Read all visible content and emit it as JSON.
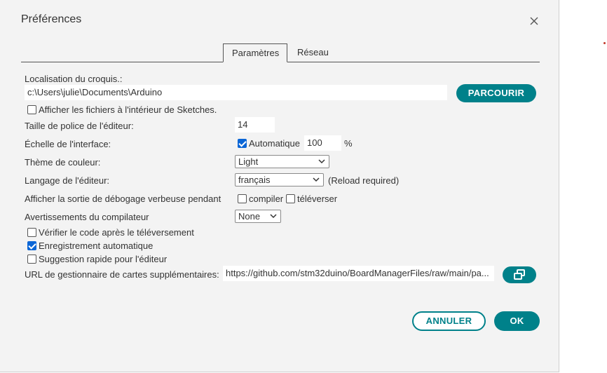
{
  "dialog": {
    "title": "Préférences"
  },
  "tabs": [
    {
      "label": "Paramètres"
    },
    {
      "label": "Réseau"
    }
  ],
  "sketchbook": {
    "label": "Localisation du croquis.:",
    "path": "c:\\Users\\julie\\Documents\\Arduino",
    "browse_label": "PARCOURIR",
    "show_files_label": "Afficher les fichiers à l'intérieur de Sketches.",
    "show_files_checked": false
  },
  "font_size": {
    "label": "Taille de police de l'éditeur:",
    "value": "14"
  },
  "scale": {
    "label": "Échelle de l'interface:",
    "auto_label": "Automatique",
    "auto_checked": true,
    "value": "100",
    "unit": "%"
  },
  "theme": {
    "label": "Thème de couleur:",
    "value": "Light"
  },
  "language": {
    "label": "Langage de l'éditeur:",
    "value": "français",
    "note": "(Reload required)"
  },
  "verbose": {
    "label": "Afficher la sortie de débogage verbeuse pendant",
    "compile_label": "compiler",
    "compile_checked": false,
    "upload_label": "téléverser",
    "upload_checked": false
  },
  "warnings": {
    "label": "Avertissements du compilateur",
    "value": "None"
  },
  "checkboxes": [
    {
      "label": "Vérifier le code après le téléversement",
      "checked": false
    },
    {
      "label": "Enregistrement automatique",
      "checked": true
    },
    {
      "label": "Suggestion rapide pour l'éditeur",
      "checked": false
    }
  ],
  "board_urls": {
    "label": "URL de gestionnaire de cartes supplémentaires:",
    "value": "https://github.com/stm32duino/BoardManagerFiles/raw/main/pa...",
    "button_icon": "open-in-window-icon"
  },
  "footer": {
    "cancel_label": "ANNULER",
    "ok_label": "OK"
  },
  "colors": {
    "accent": "#00818a",
    "checkbox": "#0b66d6",
    "background": "#f3f3f3"
  }
}
